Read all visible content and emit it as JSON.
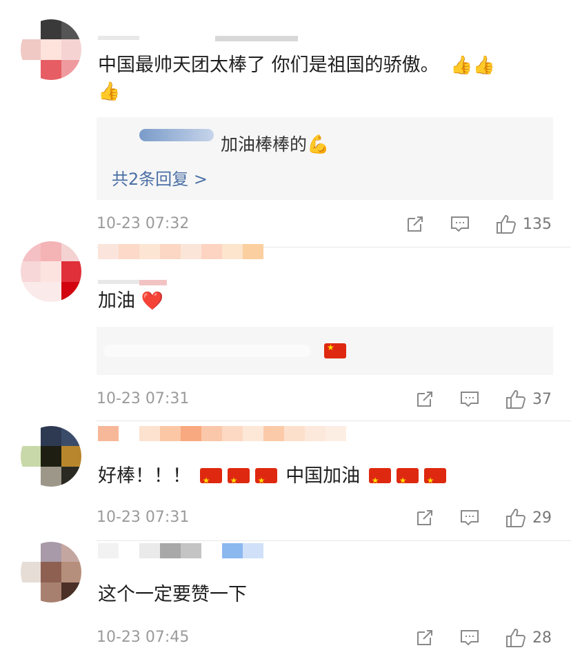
{
  "comments": [
    {
      "text": "中国最帅天团太棒了 你们是祖国的骄傲。",
      "text_emoji": "👍👍",
      "text_emoji_wrap": "👍",
      "reply": {
        "text": "加油棒棒的",
        "emoji": "💪",
        "more": "共2条回复 >"
      },
      "time": "10-23 07:32",
      "likes": "135"
    },
    {
      "text": "加油",
      "text_emoji": "❤️",
      "time": "10-23 07:31",
      "likes": "37"
    },
    {
      "text_pre": "好棒！！！",
      "text_mid": "中国加油",
      "time": "10-23 07:31",
      "likes": "29"
    },
    {
      "text": "这个一定要赞一下",
      "time": "10-23 07:45",
      "likes": "28"
    }
  ],
  "icons": {
    "share": "share-icon",
    "comment": "comment-icon",
    "like": "thumbs-up-icon"
  },
  "colors": {
    "link": "#4a6fa5",
    "meta": "#9a9a9a",
    "reply_bg": "#f6f6f6",
    "flag_red": "#de2910"
  }
}
